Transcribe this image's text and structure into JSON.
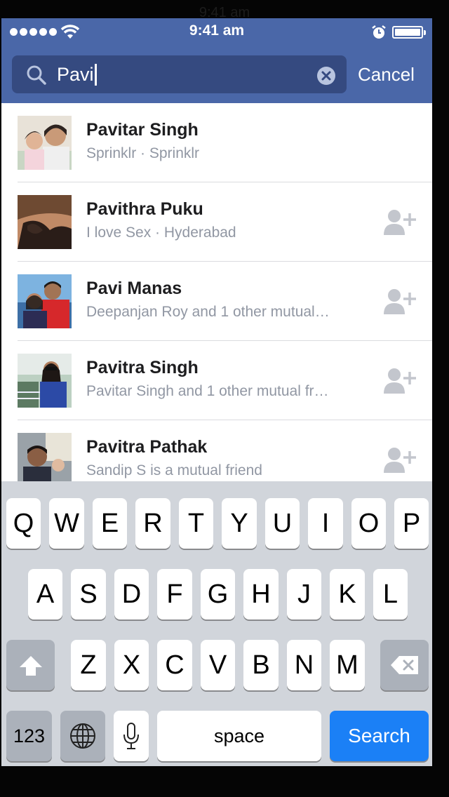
{
  "ghost_time": "9:41 am",
  "status": {
    "time": "9:41 am"
  },
  "search": {
    "value": "Pavi",
    "cancel_label": "Cancel"
  },
  "results": [
    {
      "name": "Pavitar Singh",
      "subtitle": "Sprinklr · Sprinklr",
      "can_add": false
    },
    {
      "name": "Pavithra Puku",
      "subtitle": "I love Sex · Hyderabad",
      "can_add": true
    },
    {
      "name": "Pavi Manas",
      "subtitle": "Deepanjan Roy and 1 other mutual…",
      "can_add": true
    },
    {
      "name": "Pavitra Singh",
      "subtitle": "Pavitar Singh and 1 other mutual fr…",
      "can_add": true
    },
    {
      "name": "Pavitra Pathak",
      "subtitle": "Sandip S is a mutual friend",
      "can_add": true
    }
  ],
  "keyboard": {
    "row1": [
      "Q",
      "W",
      "E",
      "R",
      "T",
      "Y",
      "U",
      "I",
      "O",
      "P"
    ],
    "row2": [
      "A",
      "S",
      "D",
      "F",
      "G",
      "H",
      "J",
      "K",
      "L"
    ],
    "row3": [
      "Z",
      "X",
      "C",
      "V",
      "B",
      "N",
      "M"
    ],
    "numbers_label": "123",
    "space_label": "space",
    "search_label": "Search"
  },
  "colors": {
    "header": "#4a67a8",
    "search_field": "#354a80",
    "search_key": "#1b80f6",
    "keyboard_bg": "#d1d5db"
  },
  "icons": [
    "search-icon",
    "clear-icon",
    "add-friend-icon",
    "shift-icon",
    "backspace-icon",
    "globe-icon",
    "microphone-icon",
    "wifi-icon",
    "alarm-icon",
    "battery-icon"
  ]
}
